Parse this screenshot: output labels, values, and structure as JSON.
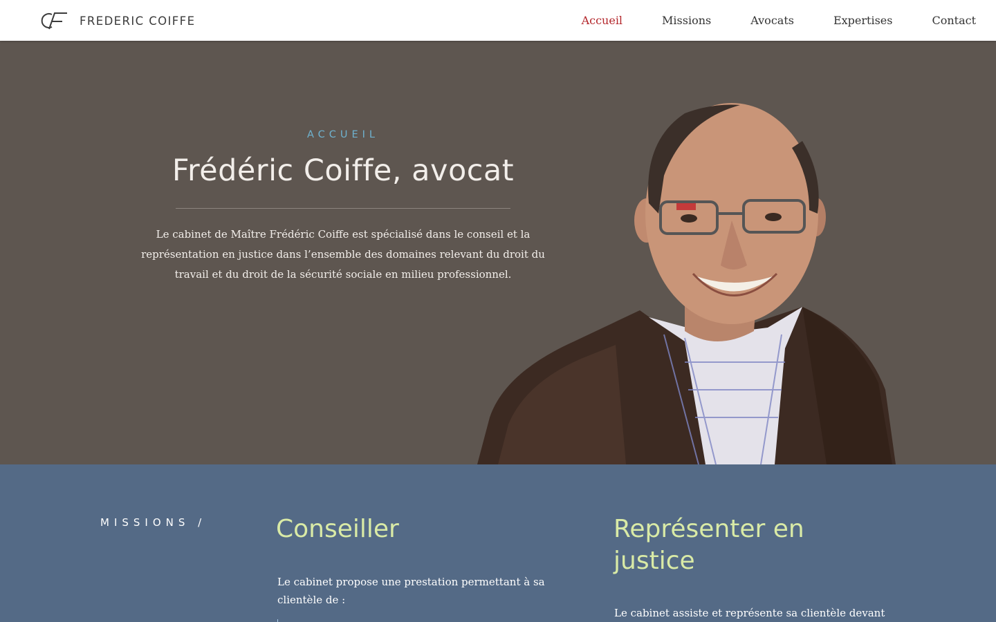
{
  "header": {
    "logo_text": "FREDERIC COIFFE",
    "nav": {
      "accueil": "Accueil",
      "missions": "Missions",
      "avocats": "Avocats",
      "expertises": "Expertises",
      "contact": "Contact"
    },
    "active_item": "Accueil"
  },
  "hero": {
    "eyebrow": "ACCUEIL",
    "title": "Frédéric Coiffe, avocat",
    "text": "Le cabinet de Maître Frédéric Coiffe est spécialisé dans le conseil et la représentation en justice dans l’ensemble des domaines relevant du droit du travail et du droit de la sécurité sociale en milieu professionnel."
  },
  "missions": {
    "label": "MISSIONS /",
    "col1": {
      "title": "Conseiller",
      "text": "Le cabinet propose une prestation permettant à sa clientèle de :"
    },
    "col2": {
      "title": "Représenter en justice",
      "text": "Le cabinet assiste et représente sa clientèle devant"
    }
  },
  "colors": {
    "header_bg": "#ffffff",
    "nav_active": "#b3262b",
    "hero_bg": "#5e5650",
    "eyebrow": "#6fb2cf",
    "missions_bg": "#546a86",
    "missions_title": "#d9eaa6"
  }
}
